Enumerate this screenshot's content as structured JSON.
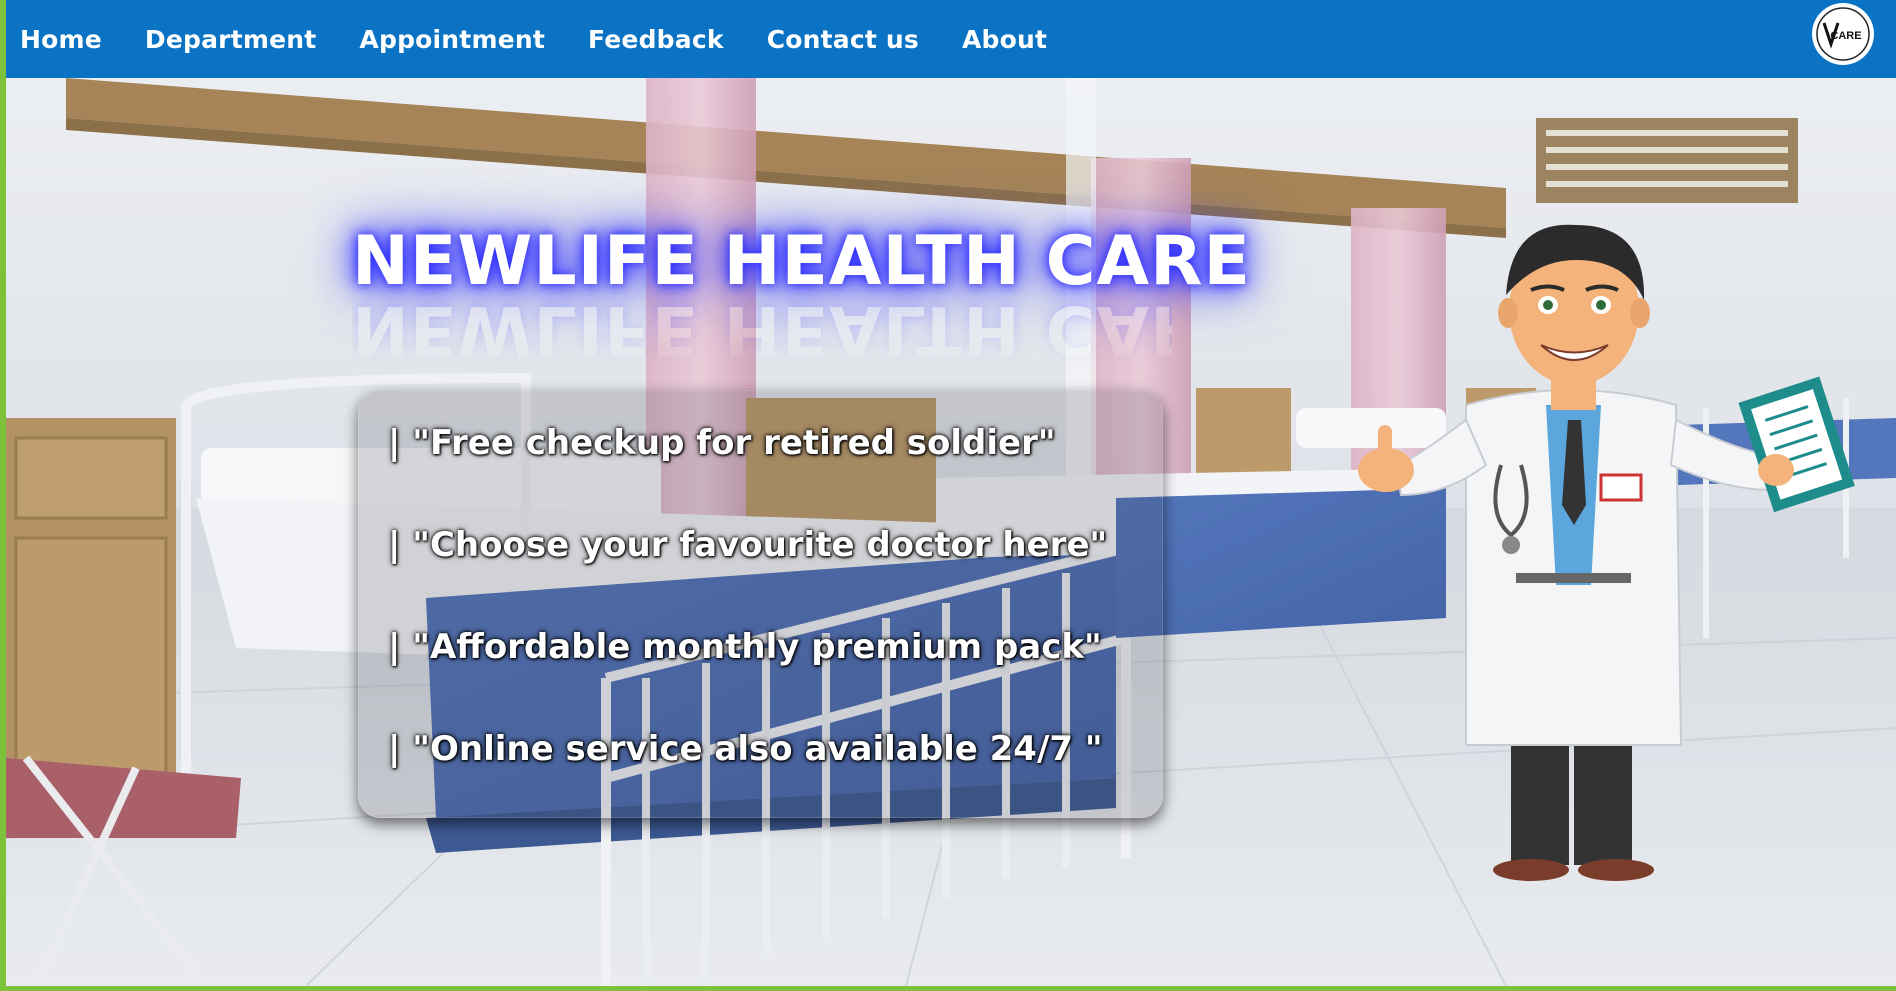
{
  "nav": {
    "items": [
      {
        "label": "Home"
      },
      {
        "label": "Department"
      },
      {
        "label": "Appointment"
      },
      {
        "label": "Feedback"
      },
      {
        "label": "Contact us"
      },
      {
        "label": "About"
      }
    ],
    "logo_text": "CARE",
    "logo_icon": "v-care-logo-icon"
  },
  "hero": {
    "title": "NEWLIFE HEALTH CARE",
    "features": [
      "| \"Free checkup for retired soldier\"",
      "| \"Choose your favourite doctor here\"",
      "| \"Affordable monthly premium pack\"",
      "| \"Online service also available 24/7 \""
    ],
    "background_icon": "hospital-ward-image",
    "mascot_icon": "doctor-cartoon-icon"
  },
  "colors": {
    "nav_bg": "#0a73c4",
    "page_border": "#7cc23a",
    "title_glow": "#3b3bff",
    "text": "#ffffff"
  }
}
